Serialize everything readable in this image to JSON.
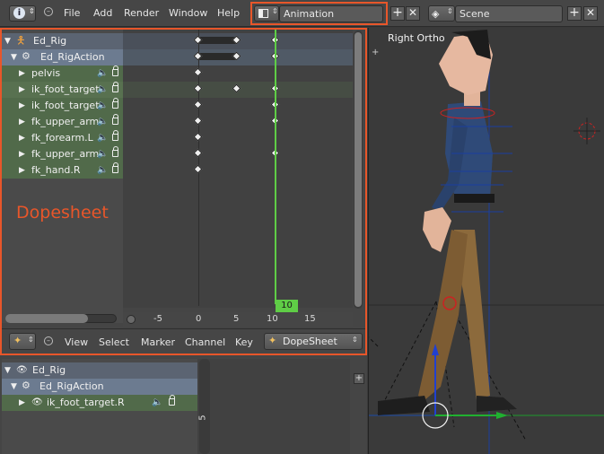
{
  "topbar": {
    "menus": [
      "File",
      "Add",
      "Render",
      "Window",
      "Help"
    ],
    "screen_layout": "Animation",
    "scene": "Scene"
  },
  "dopesheet": {
    "object": "Ed_Rig",
    "action": "Ed_RigAction",
    "channels": [
      "pelvis",
      "ik_foot_target",
      "ik_foot_target",
      "fk_upper_arm",
      "fk_forearm.L",
      "fk_upper_arm",
      "fk_hand.R"
    ],
    "current_frame": "10",
    "ruler_ticks": [
      "-5",
      "0",
      "5",
      "10",
      "15"
    ],
    "label": "Dopesheet",
    "header_menus": [
      "View",
      "Select",
      "Marker",
      "Channel",
      "Key"
    ],
    "mode": "DopeSheet"
  },
  "lower_editor": {
    "object": "Ed_Rig",
    "action": "Ed_RigAction",
    "channel": "ik_foot_target.R",
    "scroll_value": "5"
  },
  "viewport": {
    "view_label": "Right Ortho"
  },
  "colors": {
    "highlight": "#e8562a",
    "playhead": "#5fcd46",
    "channel_green": "#516a4a",
    "action_blue": "#6c7b90"
  }
}
